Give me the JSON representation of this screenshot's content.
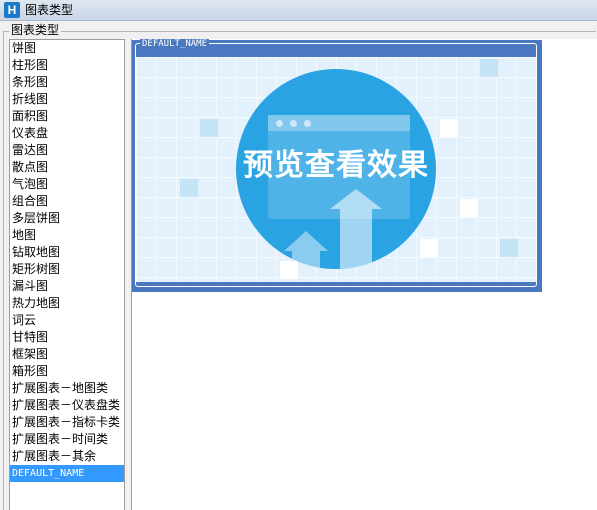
{
  "window": {
    "title": "图表类型",
    "app_icon": "app-logo-icon"
  },
  "group": {
    "label": "图表类型"
  },
  "chart_type_list": {
    "items": [
      {
        "label": "饼图"
      },
      {
        "label": "柱形图"
      },
      {
        "label": "条形图"
      },
      {
        "label": "折线图"
      },
      {
        "label": "面积图"
      },
      {
        "label": "仪表盘"
      },
      {
        "label": "雷达图"
      },
      {
        "label": "散点图"
      },
      {
        "label": "气泡图"
      },
      {
        "label": "组合图"
      },
      {
        "label": "多层饼图"
      },
      {
        "label": "地图"
      },
      {
        "label": "钻取地图"
      },
      {
        "label": "矩形树图"
      },
      {
        "label": "漏斗图"
      },
      {
        "label": "热力地图"
      },
      {
        "label": "词云"
      },
      {
        "label": "甘特图"
      },
      {
        "label": "框架图"
      },
      {
        "label": "箱形图"
      },
      {
        "label": "扩展图表－地图类"
      },
      {
        "label": "扩展图表－仪表盘类"
      },
      {
        "label": "扩展图表－指标卡类"
      },
      {
        "label": "扩展图表－时间类"
      },
      {
        "label": "扩展图表－其余"
      },
      {
        "label": "DEFAULT_NAME"
      }
    ],
    "selected_index": 25
  },
  "preview": {
    "group_label": "DEFAULT_NAME",
    "image_text": "预览查看效果",
    "colors": {
      "frame": "#4a78c0",
      "background": "#e2f1fb",
      "circle": "#2aa3e2",
      "selection": "#3399ff"
    }
  }
}
